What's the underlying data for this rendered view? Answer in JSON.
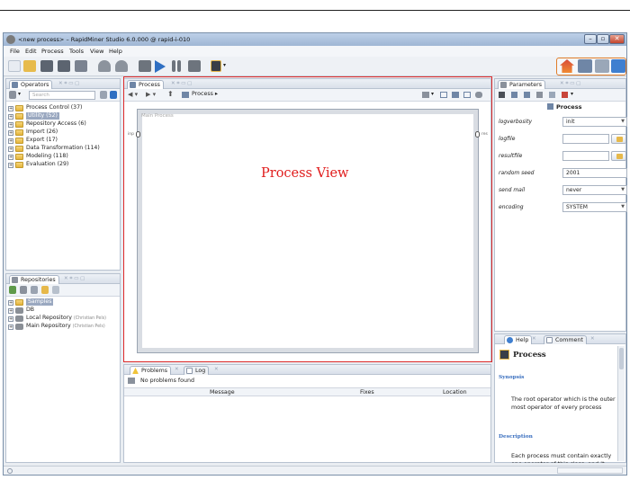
{
  "window": {
    "title": "<new process> – RapidMiner Studio 6.0.000 @ rapid-i-010",
    "btn_min": "–",
    "btn_max": "▫",
    "btn_close": "✕"
  },
  "menu": [
    "File",
    "Edit",
    "Process",
    "Tools",
    "View",
    "Help"
  ],
  "operators_panel": {
    "tab_label": "Operators",
    "search_placeholder": "Search",
    "items": [
      {
        "label": "Process Control (37)",
        "selected": false
      },
      {
        "label": "Utility (52)",
        "selected": true
      },
      {
        "label": "Repository Access (6)",
        "selected": false
      },
      {
        "label": "Import (26)",
        "selected": false
      },
      {
        "label": "Export (17)",
        "selected": false
      },
      {
        "label": "Data Transformation (114)",
        "selected": false
      },
      {
        "label": "Modeling (118)",
        "selected": false
      },
      {
        "label": "Evaluation (29)",
        "selected": false
      }
    ]
  },
  "repositories_panel": {
    "tab_label": "Repositories",
    "items": [
      {
        "label": "Samples",
        "note": "",
        "selected": true
      },
      {
        "label": "DB",
        "note": "",
        "selected": false
      },
      {
        "label": "Local Repository",
        "note": "(Christian Pels)",
        "selected": false
      },
      {
        "label": "Main Repository",
        "note": "(Christian Pels)",
        "selected": false
      }
    ]
  },
  "process_panel": {
    "tab_label": "Process",
    "breadcrumb": "Process",
    "breadcrumb_arrow": "▸",
    "canvas_title": "Main Process",
    "port_in": "inp",
    "port_out": "res",
    "overlay_label": "Process View"
  },
  "problems_panel": {
    "tab_problems": "Problems",
    "tab_log": "Log",
    "status": "No problems found",
    "columns": [
      "Message",
      "Fixes",
      "Location"
    ]
  },
  "parameters_panel": {
    "tab_label": "Parameters",
    "operator_name": "Process",
    "params": [
      {
        "label": "logverbosity",
        "value": "init",
        "kind": "dropdown"
      },
      {
        "label": "logfile",
        "value": "",
        "kind": "file"
      },
      {
        "label": "resultfile",
        "value": "",
        "kind": "file"
      },
      {
        "label": "random seed",
        "value": "2001",
        "kind": "text"
      },
      {
        "label": "send mail",
        "value": "never",
        "kind": "dropdown"
      },
      {
        "label": "encoding",
        "value": "SYSTEM",
        "kind": "dropdown"
      }
    ]
  },
  "help_panel": {
    "tab_help": "Help",
    "tab_comment": "Comment",
    "heading": "Process",
    "synopsis_title": "Synopsis",
    "synopsis_text": "The root operator which is the outer most operator of every process",
    "description_title": "Description",
    "description_text": "Each process must contain exactly one operator of this class, and it must be the root operator of the process. This operator provides a set of"
  },
  "colors": {
    "highlight_frame": "#dd2a2a",
    "overlay_text": "#e01b1b",
    "perspective_border": "#e07d2a"
  }
}
